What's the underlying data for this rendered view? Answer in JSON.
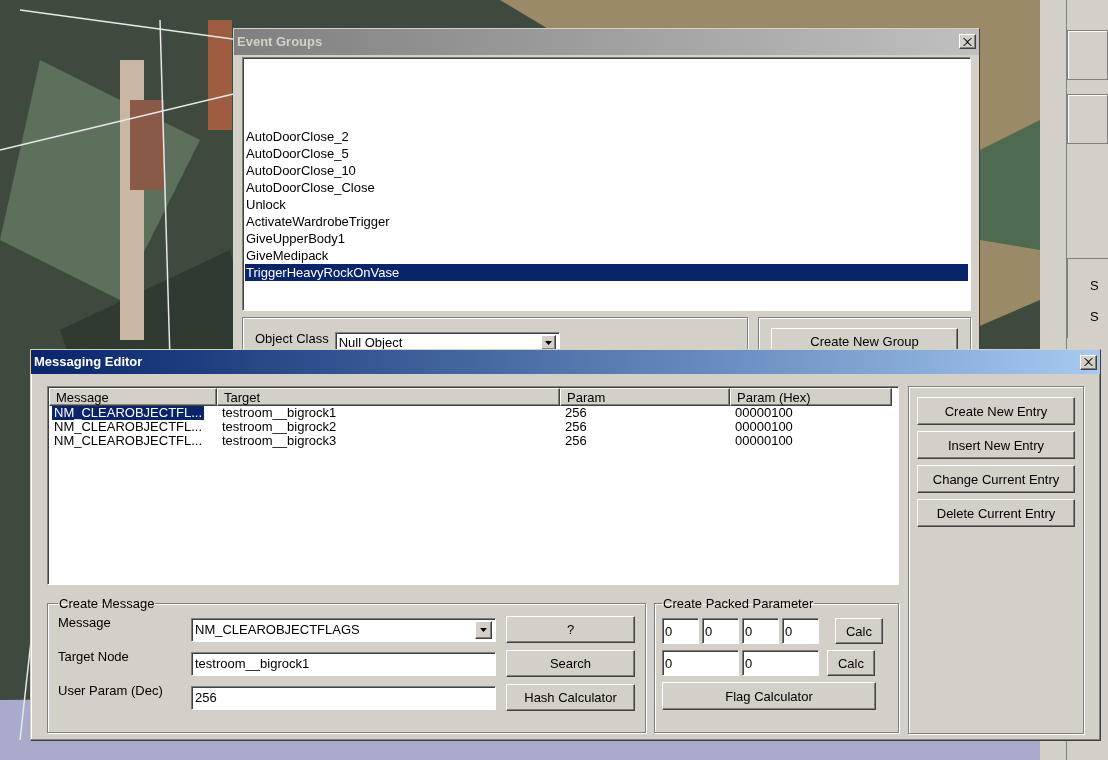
{
  "side_panel": {
    "labels": [
      "S",
      "S"
    ]
  },
  "event_groups": {
    "title": "Event Groups",
    "items": [
      {
        "label": "AutoDoorClose_2",
        "selected": false
      },
      {
        "label": "AutoDoorClose_5",
        "selected": false
      },
      {
        "label": "AutoDoorClose_10",
        "selected": false
      },
      {
        "label": "AutoDoorClose_Close",
        "selected": false
      },
      {
        "label": "Unlock",
        "selected": false
      },
      {
        "label": "ActivateWardrobeTrigger",
        "selected": false
      },
      {
        "label": "GiveUpperBody1",
        "selected": false
      },
      {
        "label": "GiveMedipack",
        "selected": false
      },
      {
        "label": "TriggerHeavyRockOnVase",
        "selected": true
      }
    ],
    "object_class_label": "Object Class",
    "object_class_value": "Null Object",
    "create_button": "Create New Group"
  },
  "messaging_editor": {
    "title": "Messaging Editor",
    "columns": [
      "Message",
      "Target",
      "Param",
      "Param (Hex)"
    ],
    "rows": [
      {
        "cells": [
          "NM_CLEAROBJECTFL...",
          "testroom__bigrock1",
          "256",
          "00000100"
        ],
        "selected": true
      },
      {
        "cells": [
          "NM_CLEAROBJECTFL...",
          "testroom__bigrock2",
          "256",
          "00000100"
        ],
        "selected": false
      },
      {
        "cells": [
          "NM_CLEAROBJECTFL...",
          "testroom__bigrock3",
          "256",
          "00000100"
        ],
        "selected": false
      }
    ],
    "side_buttons": [
      "Create New Entry",
      "Insert New Entry",
      "Change Current Entry",
      "Delete Current Entry"
    ],
    "create_message": {
      "title": "Create Message",
      "fields": [
        {
          "label": "Message",
          "value": "NM_CLEAROBJECTFLAGS",
          "kind": "dropdown",
          "button": "?"
        },
        {
          "label": "Target Node",
          "value": "testroom__bigrock1",
          "kind": "text",
          "button": "Search"
        },
        {
          "label": "User Param (Dec)",
          "value": "256",
          "kind": "text",
          "button": "Hash Calculator"
        }
      ]
    },
    "packed_parameter": {
      "title": "Create Packed Parameter",
      "row_1": [
        "0",
        "0",
        "0",
        "0"
      ],
      "row_2": [
        "0",
        "0"
      ],
      "calc_buttons": [
        "Calc",
        "Calc"
      ],
      "flag_button": "Flag Calculator"
    }
  }
}
